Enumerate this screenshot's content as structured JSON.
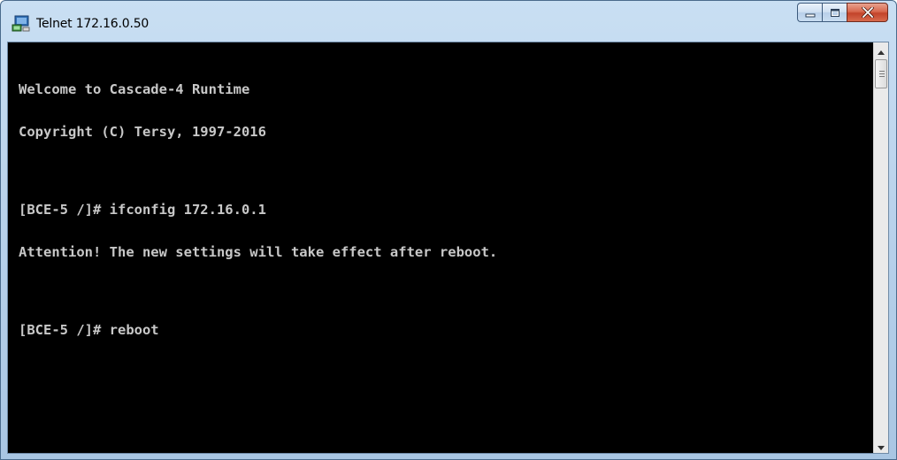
{
  "window": {
    "title": "Telnet 172.16.0.50"
  },
  "caption_buttons": {
    "minimize_icon": "minimize-icon",
    "maximize_icon": "maximize-icon",
    "close_icon": "close-icon"
  },
  "terminal": {
    "lines": [
      "Welcome to Cascade-4 Runtime",
      "Copyright (C) Tersy, 1997-2016",
      "",
      "[BCE-5 /]# ifconfig 172.16.0.1",
      "Attention! The new settings will take effect after reboot.",
      "",
      "[BCE-5 /]# reboot"
    ]
  },
  "scrollbar": {
    "up_icon": "scroll-up-arrow-icon",
    "down_icon": "scroll-down-arrow-icon"
  },
  "colors": {
    "terminal_bg": "#000000",
    "terminal_fg": "#c8c8c8",
    "close_button": "#c3432a"
  }
}
